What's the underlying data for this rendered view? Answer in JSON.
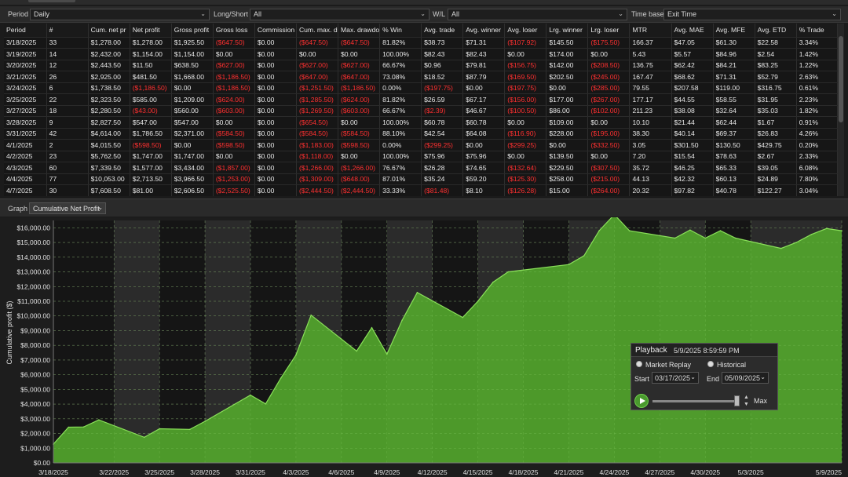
{
  "filters": {
    "period_label": "Period",
    "period_value": "Daily",
    "longshort_label": "Long/Short",
    "longshort_value": "All",
    "wl_label": "W/L",
    "wl_value": "All",
    "timebase_label": "Time base",
    "timebase_value": "Exit Time"
  },
  "table": {
    "columns": [
      "Period",
      "#",
      "Cum. net pr",
      "Net profit",
      "Gross profit",
      "Gross loss",
      "Commission",
      "Cum. max. d",
      "Max. drawdo",
      "% Win",
      "Avg. trade",
      "Avg. winner",
      "Avg. loser",
      "Lrg. winner",
      "Lrg. loser",
      "MTR",
      "Avg. MAE",
      "Avg. MFE",
      "Avg. ETD",
      "% Trade"
    ],
    "rows": [
      [
        "3/18/2025",
        "33",
        "$1,278.00",
        "$1,278.00",
        "$1,925.50",
        "($647.50)",
        "$0.00",
        "($647.50)",
        "($647.50)",
        "81.82%",
        "$38.73",
        "$71.31",
        "($107.92)",
        "$145.50",
        "($175.50)",
        "166.37",
        "$47.05",
        "$61.30",
        "$22.58",
        "3.34%"
      ],
      [
        "3/19/2025",
        "14",
        "$2,432.00",
        "$1,154.00",
        "$1,154.00",
        "$0.00",
        "$0.00",
        "$0.00",
        "$0.00",
        "100.00%",
        "$82.43",
        "$82.43",
        "$0.00",
        "$174.00",
        "$0.00",
        "5.43",
        "$5.57",
        "$84.96",
        "$2.54",
        "1.42%"
      ],
      [
        "3/20/2025",
        "12",
        "$2,443.50",
        "$11.50",
        "$638.50",
        "($627.00)",
        "$0.00",
        "($627.00)",
        "($627.00)",
        "66.67%",
        "$0.96",
        "$79.81",
        "($156.75)",
        "$142.00",
        "($208.50)",
        "136.75",
        "$62.42",
        "$84.21",
        "$83.25",
        "1.22%"
      ],
      [
        "3/21/2025",
        "26",
        "$2,925.00",
        "$481.50",
        "$1,668.00",
        "($1,186.50)",
        "$0.00",
        "($647.00)",
        "($647.00)",
        "73.08%",
        "$18.52",
        "$87.79",
        "($169.50)",
        "$202.50",
        "($245.00)",
        "167.47",
        "$68.62",
        "$71.31",
        "$52.79",
        "2.63%"
      ],
      [
        "3/24/2025",
        "6",
        "$1,738.50",
        "($1,186.50)",
        "$0.00",
        "($1,186.50)",
        "$0.00",
        "($1,251.50)",
        "($1,186.50)",
        "0.00%",
        "($197.75)",
        "$0.00",
        "($197.75)",
        "$0.00",
        "($285.00)",
        "79.55",
        "$207.58",
        "$119.00",
        "$316.75",
        "0.61%"
      ],
      [
        "3/25/2025",
        "22",
        "$2,323.50",
        "$585.00",
        "$1,209.00",
        "($624.00)",
        "$0.00",
        "($1,285.50)",
        "($624.00)",
        "81.82%",
        "$26.59",
        "$67.17",
        "($156.00)",
        "$177.00",
        "($267.00)",
        "177.17",
        "$44.55",
        "$58.55",
        "$31.95",
        "2.23%"
      ],
      [
        "3/27/2025",
        "18",
        "$2,280.50",
        "($43.00)",
        "$560.00",
        "($603.00)",
        "$0.00",
        "($1,269.50)",
        "($603.00)",
        "66.67%",
        "($2.39)",
        "$46.67",
        "($100.50)",
        "$86.00",
        "($102.00)",
        "211.23",
        "$38.08",
        "$32.64",
        "$35.03",
        "1.82%"
      ],
      [
        "3/28/2025",
        "9",
        "$2,827.50",
        "$547.00",
        "$547.00",
        "$0.00",
        "$0.00",
        "($654.50)",
        "$0.00",
        "100.00%",
        "$60.78",
        "$60.78",
        "$0.00",
        "$109.00",
        "$0.00",
        "10.10",
        "$21.44",
        "$62.44",
        "$1.67",
        "0.91%"
      ],
      [
        "3/31/2025",
        "42",
        "$4,614.00",
        "$1,786.50",
        "$2,371.00",
        "($584.50)",
        "$0.00",
        "($584.50)",
        "($584.50)",
        "88.10%",
        "$42.54",
        "$64.08",
        "($116.90)",
        "$228.00",
        "($195.00)",
        "38.30",
        "$40.14",
        "$69.37",
        "$26.83",
        "4.26%"
      ],
      [
        "4/1/2025",
        "2",
        "$4,015.50",
        "($598.50)",
        "$0.00",
        "($598.50)",
        "$0.00",
        "($1,183.00)",
        "($598.50)",
        "0.00%",
        "($299.25)",
        "$0.00",
        "($299.25)",
        "$0.00",
        "($332.50)",
        "3.05",
        "$301.50",
        "$130.50",
        "$429.75",
        "0.20%"
      ],
      [
        "4/2/2025",
        "23",
        "$5,762.50",
        "$1,747.00",
        "$1,747.00",
        "$0.00",
        "$0.00",
        "($1,118.00)",
        "$0.00",
        "100.00%",
        "$75.96",
        "$75.96",
        "$0.00",
        "$139.50",
        "$0.00",
        "7.20",
        "$15.54",
        "$78.63",
        "$2.67",
        "2.33%"
      ],
      [
        "4/3/2025",
        "60",
        "$7,339.50",
        "$1,577.00",
        "$3,434.00",
        "($1,857.00)",
        "$0.00",
        "($1,266.00)",
        "($1,266.00)",
        "76.67%",
        "$26.28",
        "$74.65",
        "($132.64)",
        "$229.50",
        "($307.50)",
        "35.72",
        "$46.25",
        "$65.33",
        "$39.05",
        "6.08%"
      ],
      [
        "4/4/2025",
        "77",
        "$10,053.00",
        "$2,713.50",
        "$3,966.50",
        "($1,253.00)",
        "$0.00",
        "($1,309.00)",
        "($648.00)",
        "87.01%",
        "$35.24",
        "$59.20",
        "($125.30)",
        "$258.00",
        "($215.00)",
        "44.13",
        "$42.32",
        "$60.13",
        "$24.89",
        "7.80%"
      ],
      [
        "4/7/2025",
        "30",
        "$7,608.50",
        "$81.00",
        "$2,606.50",
        "($2,525.50)",
        "$0.00",
        "($2,444.50)",
        "($2,444.50)",
        "33.33%",
        "($81.48)",
        "$8.10",
        "($126.28)",
        "$15.00",
        "($264.00)",
        "20.32",
        "$97.82",
        "$40.78",
        "$122.27",
        "3.04%"
      ]
    ]
  },
  "graph": {
    "label": "Graph",
    "mode": "Cumulative Net Profit"
  },
  "chart_data": {
    "type": "area",
    "ylabel": "Cumulative profit ($)",
    "ylim": [
      0,
      16500
    ],
    "yticks": [
      "$0.00",
      "$1,000.00",
      "$2,000.00",
      "$3,000.00",
      "$4,000.00",
      "$5,000.00",
      "$6,000.00",
      "$7,000.00",
      "$8,000.00",
      "$9,000.00",
      "$10,000.00",
      "$11,000.00",
      "$12,000.00",
      "$13,000.00",
      "$14,000.00",
      "$15,000.00",
      "$16,000.00"
    ],
    "xticks": [
      "3/18/2025",
      "3/22/2025",
      "3/25/2025",
      "3/28/2025",
      "3/31/2025",
      "4/3/2025",
      "4/6/2025",
      "4/9/2025",
      "4/12/2025",
      "4/15/2025",
      "4/18/2025",
      "4/21/2025",
      "4/24/2025",
      "4/27/2025",
      "4/30/2025",
      "5/3/2025",
      "5/9/2025"
    ],
    "x": [
      "3/18/2025",
      "3/19/2025",
      "3/20/2025",
      "3/21/2025",
      "3/24/2025",
      "3/25/2025",
      "3/27/2025",
      "3/28/2025",
      "3/31/2025",
      "4/1/2025",
      "4/2/2025",
      "4/3/2025",
      "4/4/2025",
      "4/7/2025",
      "4/8/2025",
      "4/9/2025",
      "4/10/2025",
      "4/11/2025",
      "4/14/2025",
      "4/15/2025",
      "4/16/2025",
      "4/17/2025",
      "4/21/2025",
      "4/22/2025",
      "4/23/2025",
      "4/24/2025",
      "4/25/2025",
      "4/28/2025",
      "4/29/2025",
      "4/30/2025",
      "5/1/2025",
      "5/2/2025",
      "5/5/2025",
      "5/6/2025",
      "5/7/2025",
      "5/8/2025",
      "5/9/2025"
    ],
    "values": [
      1278,
      2432,
      2443.5,
      2925,
      1738.5,
      2323.5,
      2280.5,
      2827.5,
      4614,
      4015.5,
      5762.5,
      7339.5,
      10053,
      7608.5,
      9200,
      7400,
      9700,
      11600,
      9900,
      11000,
      12300,
      13000,
      13500,
      14100,
      15800,
      16900,
      15800,
      15300,
      15850,
      15300,
      15800,
      15300,
      14600,
      15000,
      15550,
      15950,
      15800
    ],
    "fill": "#52a52c",
    "line": "#8ae05a"
  },
  "playback": {
    "title": "Playback",
    "timestamp": "5/9/2025 8:59:59 PM",
    "mode_market": "Market Replay",
    "mode_historical": "Historical",
    "start_label": "Start",
    "start_value": "03/17/2025",
    "end_label": "End",
    "end_value": "05/09/2025",
    "max_label": "Max"
  }
}
